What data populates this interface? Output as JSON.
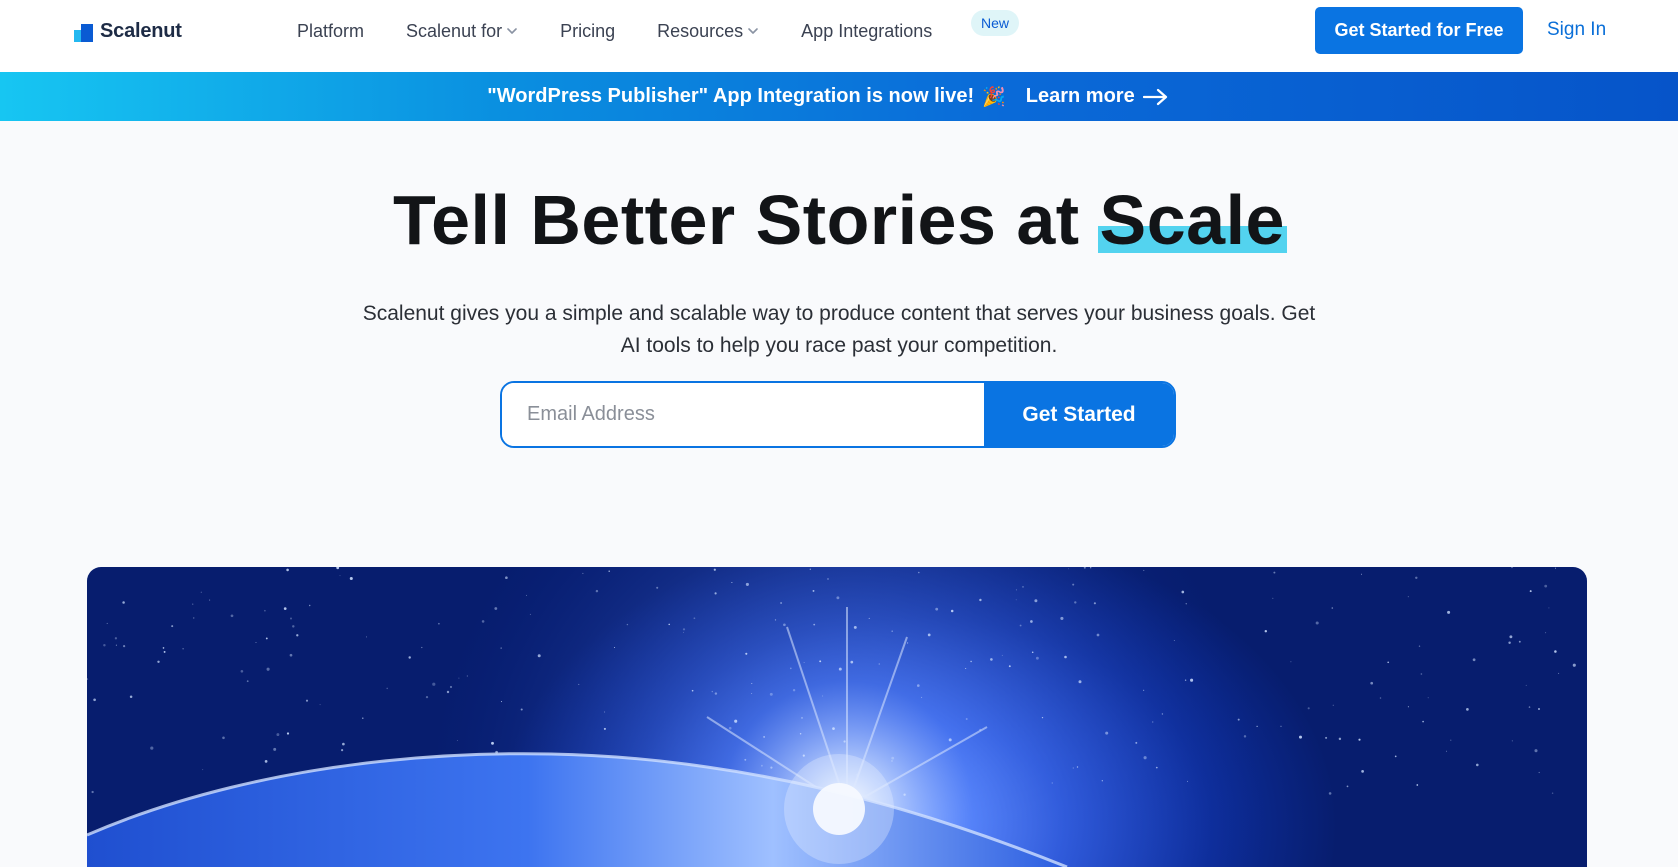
{
  "header": {
    "logo_text": "Scalenut",
    "nav": [
      {
        "label": "Platform"
      },
      {
        "label": "Scalenut for"
      },
      {
        "label": "Pricing"
      },
      {
        "label": "Resources"
      },
      {
        "label": "App Integrations"
      }
    ],
    "new_badge": "New",
    "cta_label": "Get Started for Free",
    "signin_label": "Sign In"
  },
  "banner": {
    "text": "\"WordPress Publisher\" App Integration is now live!",
    "emoji": "🎉",
    "link_label": "Learn more"
  },
  "hero": {
    "title_main": "Tell Better Stories at ",
    "title_highlight": "Scale",
    "subtitle": "Scalenut gives you a simple and scalable way to produce content that serves your business goals. Get AI tools to help you race past your competition.",
    "email_placeholder": "Email Address",
    "submit_label": "Get Started"
  },
  "colors": {
    "primary": "#0a74e2",
    "highlight": "#53d3ef",
    "banner_start": "#17c6f2",
    "banner_end": "#0654c9"
  },
  "icons": {
    "logo": "scalenut-logo-icon",
    "dropdown": "chevron-down-icon",
    "banner_arrow": "arrow-right-icon"
  }
}
